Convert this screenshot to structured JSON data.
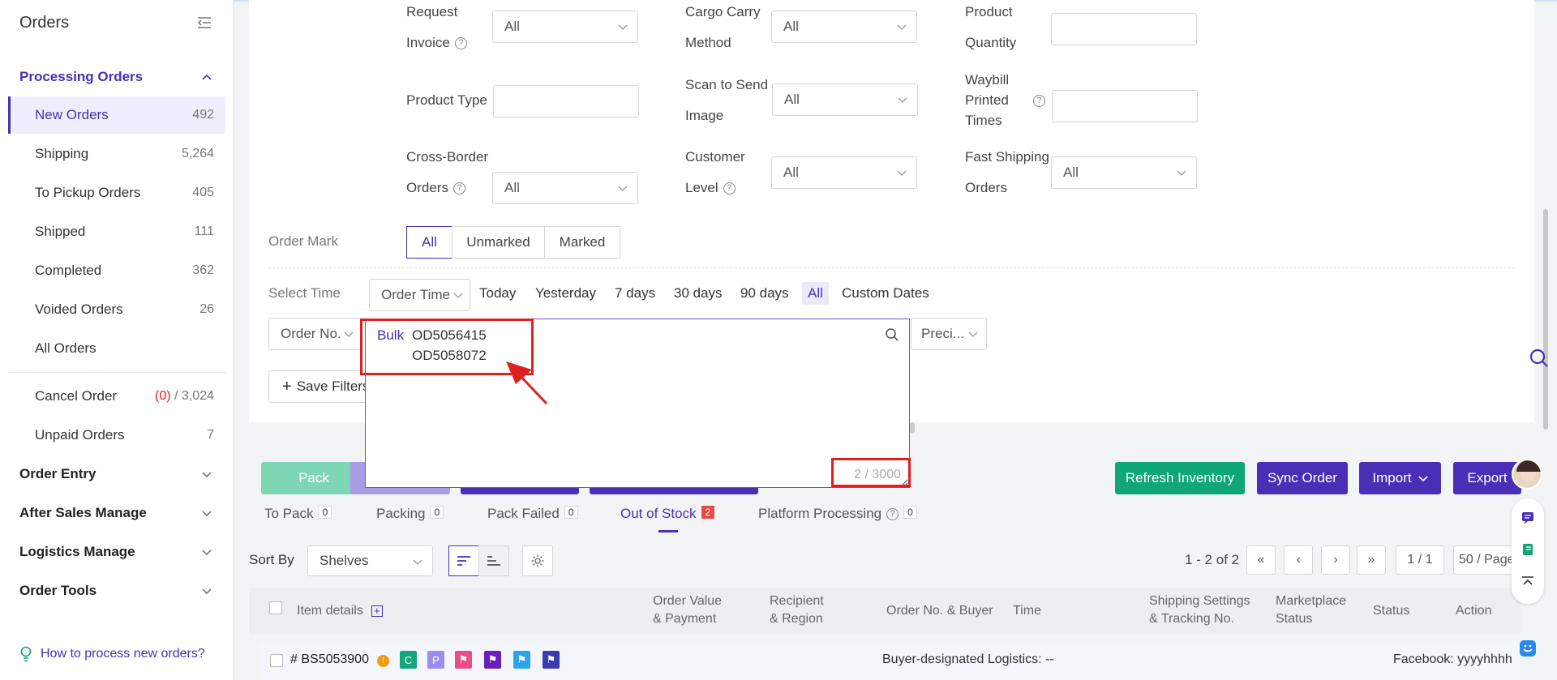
{
  "sidebar": {
    "title": "Orders",
    "processing_group": "Processing Orders",
    "items": [
      {
        "label": "New Orders",
        "count": "492"
      },
      {
        "label": "Shipping",
        "count": "5,264"
      },
      {
        "label": "To Pickup Orders",
        "count": "405"
      },
      {
        "label": "Shipped",
        "count": "111"
      },
      {
        "label": "Completed",
        "count": "362"
      },
      {
        "label": "Voided Orders",
        "count": "26"
      },
      {
        "label": "All Orders",
        "count": ""
      }
    ],
    "cancel_order": {
      "label": "Cancel Order",
      "count_red": "(0)",
      "sep": " / ",
      "count": "3,024"
    },
    "unpaid_orders": {
      "label": "Unpaid Orders",
      "count": "7"
    },
    "groups": [
      "Order Entry",
      "After Sales Manage",
      "Logistics Manage",
      "Order Tools"
    ],
    "help_link": "How to process new orders?"
  },
  "filters": {
    "request_invoice": {
      "label1": "Request",
      "label2": "Invoice",
      "value": "All"
    },
    "cargo_carry": {
      "label1": "Cargo Carry",
      "label2": "Method",
      "value": "All"
    },
    "product_quantity": {
      "label1": "Product",
      "label2": "Quantity"
    },
    "product_type": {
      "label": "Product Type"
    },
    "scan_to_send": {
      "label1": "Scan to Send",
      "label2": "Image",
      "value": "All"
    },
    "waybill_printed": {
      "label1": "Waybill",
      "label2": "Printed",
      "label3": "Times"
    },
    "cross_border": {
      "label1": "Cross-Border",
      "label2": "Orders",
      "value": "All"
    },
    "customer_level": {
      "label1": "Customer",
      "label2": "Level",
      "value": "All"
    },
    "fast_shipping": {
      "label1": "Fast Shipping",
      "label2": "Orders",
      "value": "All"
    }
  },
  "order_mark": {
    "label": "Order Mark",
    "options": [
      "All",
      "Unmarked",
      "Marked"
    ]
  },
  "select_time": {
    "label": "Select Time",
    "type": "Order Time",
    "options": [
      "Today",
      "Yesterday",
      "7 days",
      "30 days",
      "90 days",
      "All",
      "Custom Dates"
    ]
  },
  "search": {
    "field": "Order No.",
    "bulk_label": "Bulk",
    "lines": [
      "OD5056415",
      "OD5058072"
    ],
    "counter": "2 / 3000",
    "precise": "Preci..."
  },
  "save_filters": "Save Filters",
  "actions": {
    "pack": "Pack",
    "refresh_inventory": "Refresh Inventory",
    "sync_order": "Sync Order",
    "import": "Import",
    "export": "Export"
  },
  "tabs": [
    {
      "label": "To Pack",
      "count": "0"
    },
    {
      "label": "Packing",
      "count": "0"
    },
    {
      "label": "Pack Failed",
      "count": "0"
    },
    {
      "label": "Out of Stock",
      "count": "2"
    },
    {
      "label": "Platform Processing",
      "count": "0"
    }
  ],
  "sort": {
    "label": "Sort By",
    "value": "Shelves"
  },
  "pagination": {
    "range": "1 - 2 of 2",
    "page": "1 / 1",
    "per_page": "50 / Page"
  },
  "table": {
    "headers": {
      "item_details": "Item details",
      "order_value": [
        "Order Value",
        "& Payment"
      ],
      "recipient": [
        "Recipient",
        "& Region"
      ],
      "order_no": "Order No. & Buyer",
      "time": "Time",
      "shipping": [
        "Shipping Settings",
        "& Tracking No."
      ],
      "marketplace": [
        "Marketplace",
        "Status"
      ],
      "status": "Status",
      "action": "Action"
    },
    "row": {
      "id": "# BS5053900",
      "tags": [
        "C",
        "P"
      ],
      "logistics": "Buyer-designated Logistics: --",
      "buyer": "Facebook: yyyyhhhh"
    }
  },
  "colors": {
    "accent": "#4a2eb5",
    "green": "#0fa678",
    "red": "#e02020"
  }
}
